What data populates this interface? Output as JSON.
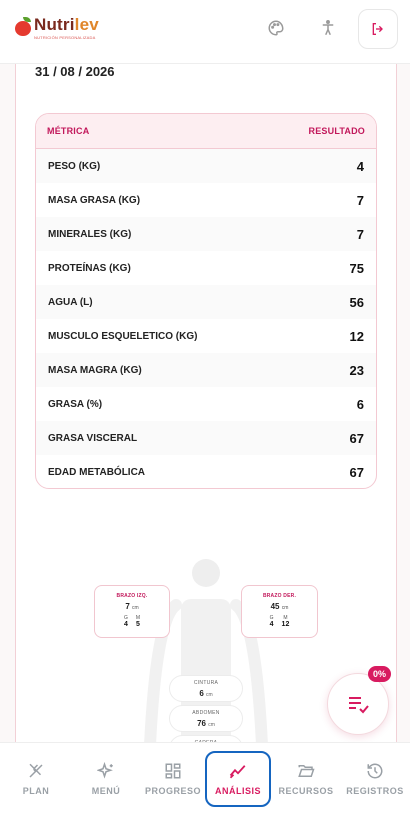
{
  "header": {
    "brand_part1": "Nutri",
    "brand_part2": "lev",
    "tagline": "NUTRICIÓN PERSONALIZADA",
    "icons": [
      "palette-icon",
      "accessibility-icon",
      "logout-icon"
    ]
  },
  "date": "31 / 08 / 2026",
  "table": {
    "col_metric": "MÉTRICA",
    "col_result": "RESULTADO",
    "rows": [
      {
        "label": "PESO (KG)",
        "value": "4"
      },
      {
        "label": "MASA GRASA (KG)",
        "value": "7"
      },
      {
        "label": "MINERALES (KG)",
        "value": "7"
      },
      {
        "label": "PROTEÍNAS (KG)",
        "value": "75"
      },
      {
        "label": "AGUA (L)",
        "value": "56"
      },
      {
        "label": "MUSCULO ESQUELETICO (KG)",
        "value": "12"
      },
      {
        "label": "MASA MAGRA (KG)",
        "value": "23"
      },
      {
        "label": "GRASA (%)",
        "value": "6"
      },
      {
        "label": "GRASA VISCERAL",
        "value": "67"
      },
      {
        "label": "EDAD METABÓLICA",
        "value": "67"
      }
    ]
  },
  "body": {
    "left_arm": {
      "title": "BRAZO IZQ.",
      "value": "7",
      "unit": "cm",
      "g_label": "G",
      "m_label": "M",
      "g": "4",
      "m": "5"
    },
    "right_arm": {
      "title": "BRAZO DER.",
      "value": "45",
      "unit": "cm",
      "g_label": "G",
      "m_label": "M",
      "g": "4",
      "m": "12"
    },
    "waist": {
      "title": "CINTURA",
      "value": "6",
      "unit": "cm"
    },
    "abdomen": {
      "title": "ABDOMEN",
      "value": "76",
      "unit": "cm"
    },
    "hip": {
      "title": "CADERA"
    }
  },
  "fab": {
    "badge": "0%"
  },
  "nav": [
    {
      "label": "PLAN"
    },
    {
      "label": "MENÚ"
    },
    {
      "label": "PROGRESO"
    },
    {
      "label": "ANÁLISIS"
    },
    {
      "label": "RECURSOS"
    },
    {
      "label": "REGISTROS"
    }
  ],
  "colors": {
    "accent": "#d81b60",
    "active_outline": "#1565c0",
    "inactive": "#9aa0a6"
  }
}
